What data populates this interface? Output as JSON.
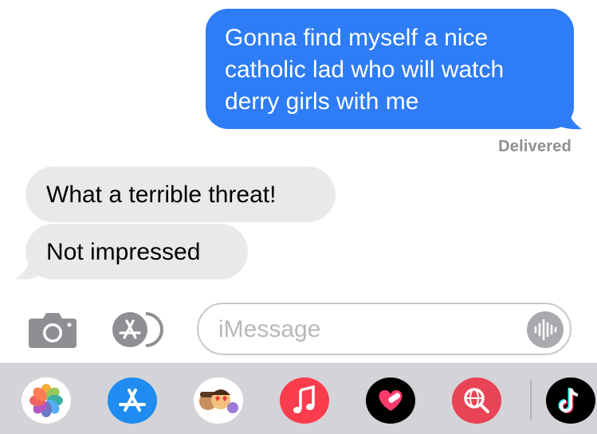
{
  "conversation": {
    "messages": [
      {
        "direction": "sent",
        "text_lines": [
          "Gonna find myself a nice",
          "catholic lad who will watch",
          "derry girls with me"
        ]
      },
      {
        "direction": "received",
        "text": "What a terrible threat!"
      },
      {
        "direction": "received",
        "text": "Not impressed"
      }
    ],
    "delivery_status": "Delivered"
  },
  "composer": {
    "placeholder": "iMessage",
    "buttons": [
      "camera-icon",
      "app-store-icon",
      "audio-message-icon"
    ]
  },
  "app_drawer": {
    "apps": [
      {
        "name": "photos-icon"
      },
      {
        "name": "app-store-icon"
      },
      {
        "name": "memoji-stickers-icon"
      },
      {
        "name": "music-icon"
      },
      {
        "name": "digital-touch-icon"
      },
      {
        "name": "images-search-icon"
      },
      {
        "name": "tiktok-icon"
      }
    ]
  },
  "colors": {
    "sent_bubble": "#2e7cf6",
    "received_bubble": "#e9e9eb",
    "delivered_text": "#8e8e93",
    "drawer_background": "#d4d4d8"
  }
}
